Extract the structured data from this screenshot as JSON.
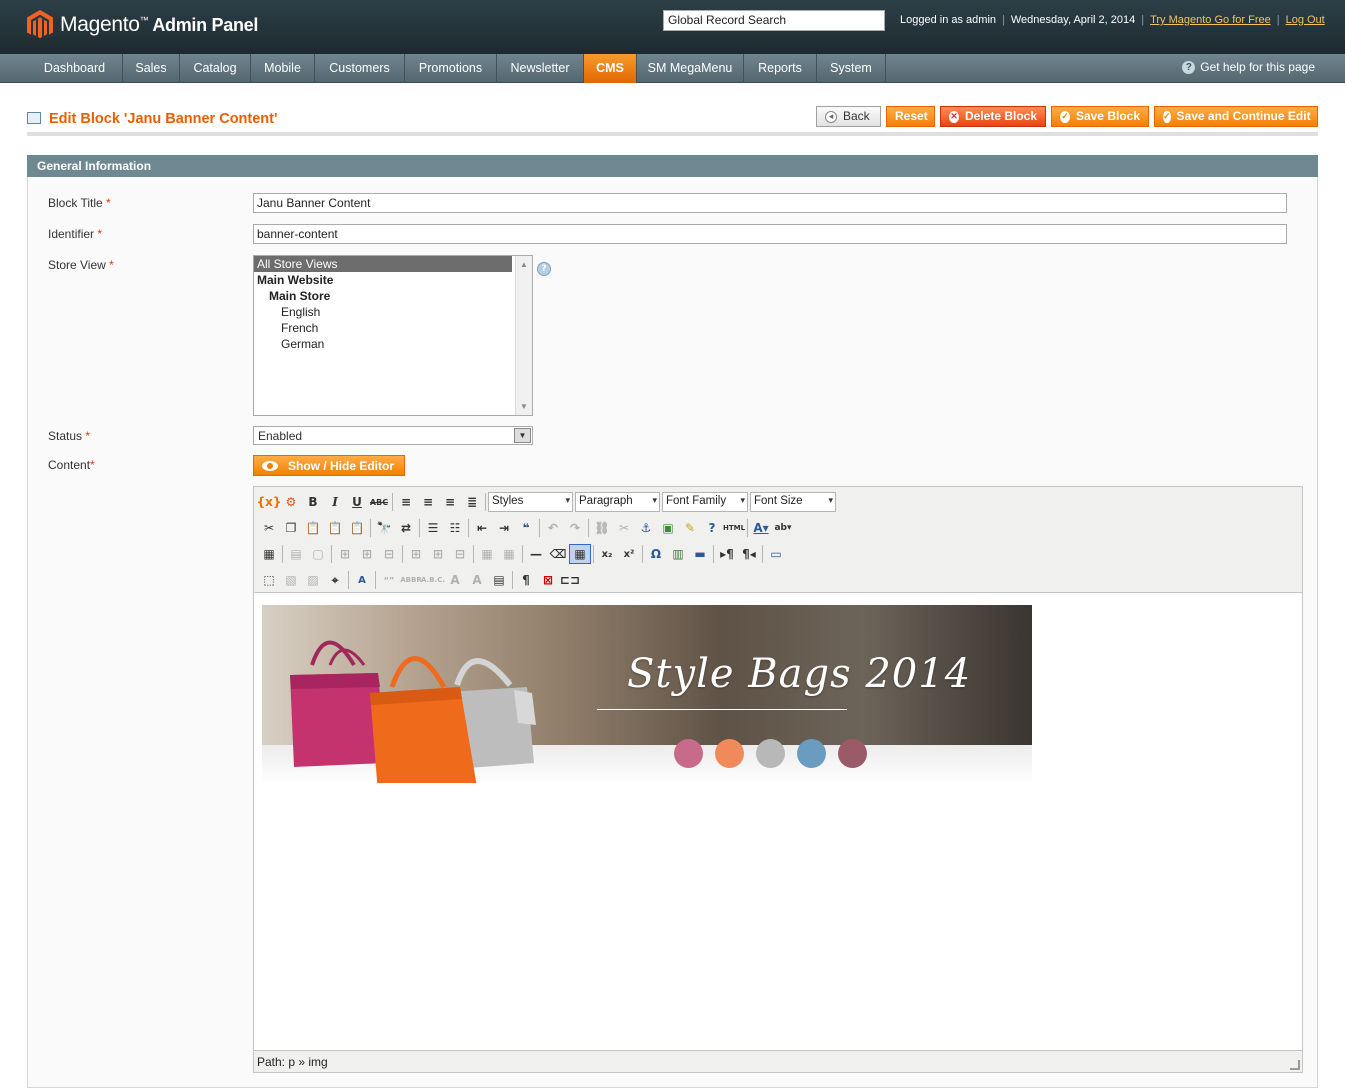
{
  "header": {
    "app_name": "Magento",
    "app_tm": "™",
    "app_suffix": "Admin Panel",
    "search_value": "Global Record Search",
    "logged_in": "Logged in as admin",
    "date": "Wednesday, April 2, 2014",
    "try_link": "Try Magento Go for Free",
    "logout_link": "Log Out"
  },
  "nav": {
    "items": [
      "Dashboard",
      "Sales",
      "Catalog",
      "Mobile",
      "Customers",
      "Promotions",
      "Newsletter",
      "CMS",
      "SM MegaMenu",
      "Reports",
      "System"
    ],
    "active": "CMS",
    "help": "Get help for this page"
  },
  "page": {
    "title": "Edit Block 'Janu Banner Content'",
    "buttons": {
      "back": "Back",
      "reset": "Reset",
      "delete": "Delete Block",
      "save": "Save Block",
      "save_continue": "Save and Continue Edit"
    }
  },
  "section": {
    "title": "General Information"
  },
  "form": {
    "block_title_label": "Block Title",
    "block_title_value": "Janu Banner Content",
    "identifier_label": "Identifier",
    "identifier_value": "banner-content",
    "store_view_label": "Store View",
    "store_views": [
      "All Store Views",
      "Main Website",
      "Main Store",
      "English",
      "French",
      "German"
    ],
    "status_label": "Status",
    "status_value": "Enabled",
    "content_label": "Content",
    "required_mark": "*",
    "show_hide_label": "Show / Hide Editor"
  },
  "editor": {
    "styles": "Styles",
    "format": "Paragraph",
    "font_family": "Font Family",
    "font_size": "Font Size",
    "path_label": "Path: p » img"
  },
  "banner": {
    "text": "Style Bags 2014",
    "dot_colors": [
      "#c86a8a",
      "#f08a5a",
      "#b8b8b8",
      "#6a9cc0",
      "#9a5a68"
    ]
  },
  "colors": {
    "accent": "#eb5e00",
    "header_bg": "#2d3f47",
    "nav_bg": "#6f8590",
    "section_bg": "#6f8992"
  }
}
